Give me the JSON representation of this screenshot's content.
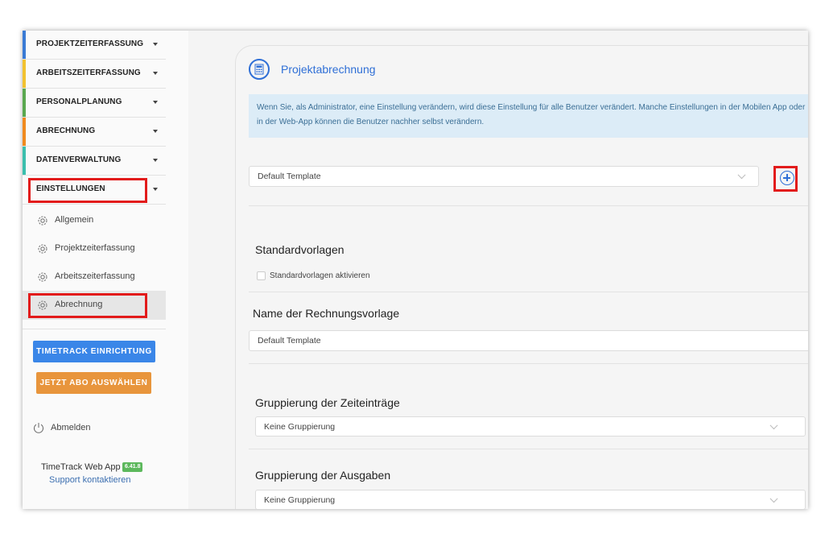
{
  "sidebar": {
    "nav": [
      {
        "label": "PROJEKTZEITERFASSUNG",
        "color": "#3a7bd5"
      },
      {
        "label": "ARBEITSZEITERFASSUNG",
        "color": "#f2c230"
      },
      {
        "label": "PERSONALPLANUNG",
        "color": "#5aa84f"
      },
      {
        "label": "ABRECHNUNG",
        "color": "#f08a1e"
      },
      {
        "label": "DATENVERWALTUNG",
        "color": "#3bbfad"
      },
      {
        "label": "EINSTELLUNGEN",
        "color": ""
      }
    ],
    "subitems": [
      {
        "label": "Allgemein"
      },
      {
        "label": "Projektzeiterfassung"
      },
      {
        "label": "Arbeitszeiterfassung"
      },
      {
        "label": "Abrechnung"
      }
    ],
    "setup_button": "TIMETRACK EINRICHTUNG",
    "abo_button": "JETZT ABO AUSWÄHLEN",
    "logout": "Abmelden",
    "app_name": "TimeTrack Web App",
    "version": "6.41.8",
    "support": "Support kontaktieren"
  },
  "main": {
    "title": "Projektabrechnung",
    "info_text": "Wenn Sie, als Administrator, eine Einstellung verändern, wird diese Einstellung für alle Benutzer verändert. Manche Einstellungen in der Mobilen App oder in der Web-App können die Benutzer nachher selbst verändern.",
    "template_select": "Default Template",
    "standard_heading": "Standardvorlagen",
    "standard_checkbox": "Standardvorlagen aktivieren",
    "name_heading": "Name der Rechnungsvorlage",
    "name_value": "Default Template",
    "group_time_heading": "Gruppierung der Zeiteinträge",
    "group_time_value": "Keine Gruppierung",
    "group_exp_heading": "Gruppierung der Ausgaben",
    "group_exp_value": "Keine Gruppierung"
  },
  "colors": {
    "accent": "#2f6fd6",
    "highlight": "#e21b1b",
    "setup_button": "#3a86e8",
    "abo_button": "#e8953c",
    "info_bg": "#dcecf7"
  }
}
